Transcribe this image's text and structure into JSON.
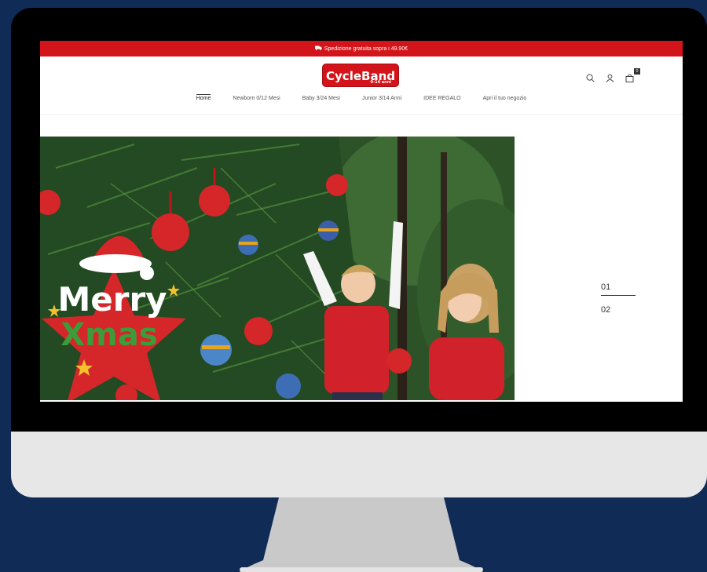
{
  "announcement": {
    "icon": "truck-icon",
    "text": "Spedizione gratuita sopra i 49.90€"
  },
  "brand": {
    "name": "CycleBand",
    "tagline": "0-14 anni",
    "color": "#d3141a"
  },
  "header_icons": {
    "search": "search-icon",
    "account": "user-icon",
    "cart": "cart-icon",
    "cart_count": "0"
  },
  "nav": {
    "items": [
      {
        "label": "Home"
      },
      {
        "label": "Newborn 0/12 Mesi"
      },
      {
        "label": "Baby 3/24 Mesi"
      },
      {
        "label": "Junior 3/14 Anni"
      },
      {
        "label": "IDEE REGALO"
      },
      {
        "label": "Apri il tuo negozio"
      }
    ]
  },
  "hero": {
    "badge_line1": "Merry",
    "badge_line2": "Xmas"
  },
  "slider": {
    "slide1": "01",
    "slide2": "02"
  }
}
